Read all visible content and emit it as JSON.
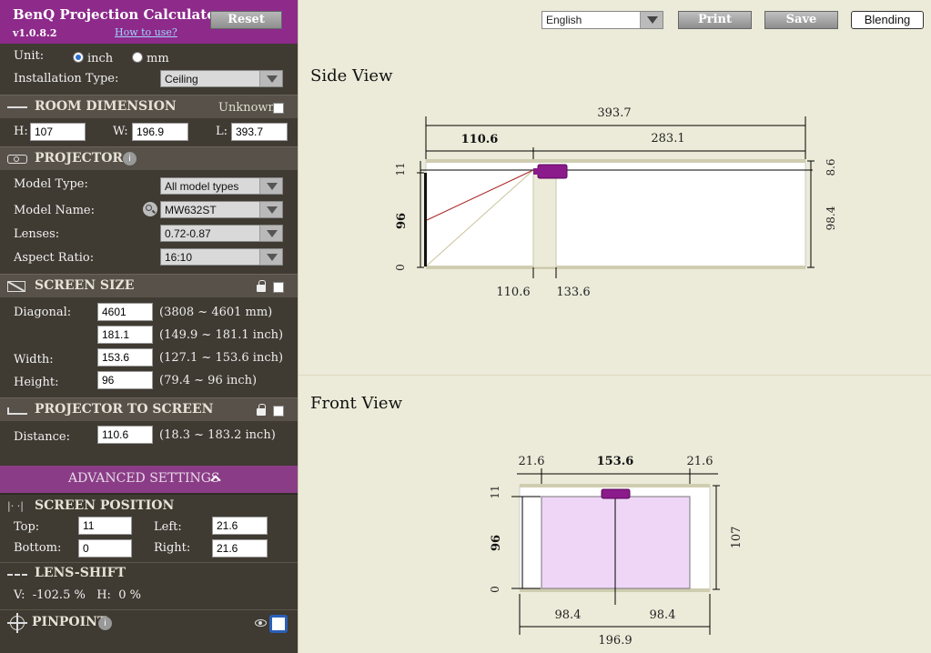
{
  "app": {
    "title": "BenQ Projection Calculator",
    "version": "v1.0.8.2",
    "reset_label": "Reset",
    "howto_label": "How to use?"
  },
  "unit": {
    "label": "Unit:",
    "option_inch": "inch",
    "option_mm": "mm",
    "selected": "inch"
  },
  "installation": {
    "label": "Installation Type:",
    "value": "Ceiling"
  },
  "room": {
    "title": "ROOM DIMENSION",
    "unknown_label": "Unknown",
    "h_label": "H:",
    "h": "107",
    "w_label": "W:",
    "w": "196.9",
    "l_label": "L:",
    "l": "393.7"
  },
  "projector": {
    "title": "PROJECTOR",
    "model_type_label": "Model Type:",
    "model_type": "All model types",
    "model_name_label": "Model Name:",
    "model_name": "MW632ST",
    "lenses_label": "Lenses:",
    "lenses": "0.72-0.87",
    "aspect_label": "Aspect Ratio:",
    "aspect": "16:10"
  },
  "screen_size": {
    "title": "SCREEN SIZE",
    "diag_label": "Diagonal:",
    "diag_mm": "4601",
    "diag_mm_range": "(3808 ~ 4601 mm)",
    "diag_inch": "181.1",
    "diag_inch_range": "(149.9 ~ 181.1 inch)",
    "width_label": "Width:",
    "width": "153.6",
    "width_range": "(127.1 ~ 153.6 inch)",
    "height_label": "Height:",
    "height": "96",
    "height_range": "(79.4 ~ 96 inch)"
  },
  "distance": {
    "title": "PROJECTOR TO SCREEN",
    "label": "Distance:",
    "value": "110.6",
    "range": "(18.3 ~ 183.2 inch)"
  },
  "advanced": {
    "label": "ADVANCED SETTINGS"
  },
  "screen_position": {
    "title": "SCREEN POSITION",
    "top_label": "Top:",
    "top": "11",
    "left_label": "Left:",
    "left": "21.6",
    "bottom_label": "Bottom:",
    "bottom": "0",
    "right_label": "Right:",
    "right": "21.6"
  },
  "lens_shift": {
    "title": "LENS-SHIFT",
    "value_text": "V:  -102.5 %   H:  0 %"
  },
  "pinpoint": {
    "title": "PINPOINT"
  },
  "toolbar": {
    "language": "English",
    "print": "Print",
    "save": "Save",
    "blending": "Blending"
  },
  "side_view": {
    "title": "Side View",
    "total": "393.7",
    "left_span": "110.6",
    "right_span": "283.1",
    "top_gap": "11",
    "screen_h": "96",
    "zero": "0",
    "right_top": "8.6",
    "right_h": "98.4",
    "bottom_a": "110.6",
    "bottom_b": "133.6"
  },
  "front_view": {
    "title": "Front View",
    "left_margin": "21.6",
    "width": "153.6",
    "right_margin": "21.6",
    "top_gap": "11",
    "screen_h": "96",
    "zero": "0",
    "room_h": "107",
    "half_left": "98.4",
    "half_right": "98.4",
    "total_w": "196.9"
  },
  "colors": {
    "header": "#8d2a8a",
    "sidebar": "#3f3a32",
    "projector": "#8b1a8b",
    "front_screen": "#efd6f7"
  }
}
